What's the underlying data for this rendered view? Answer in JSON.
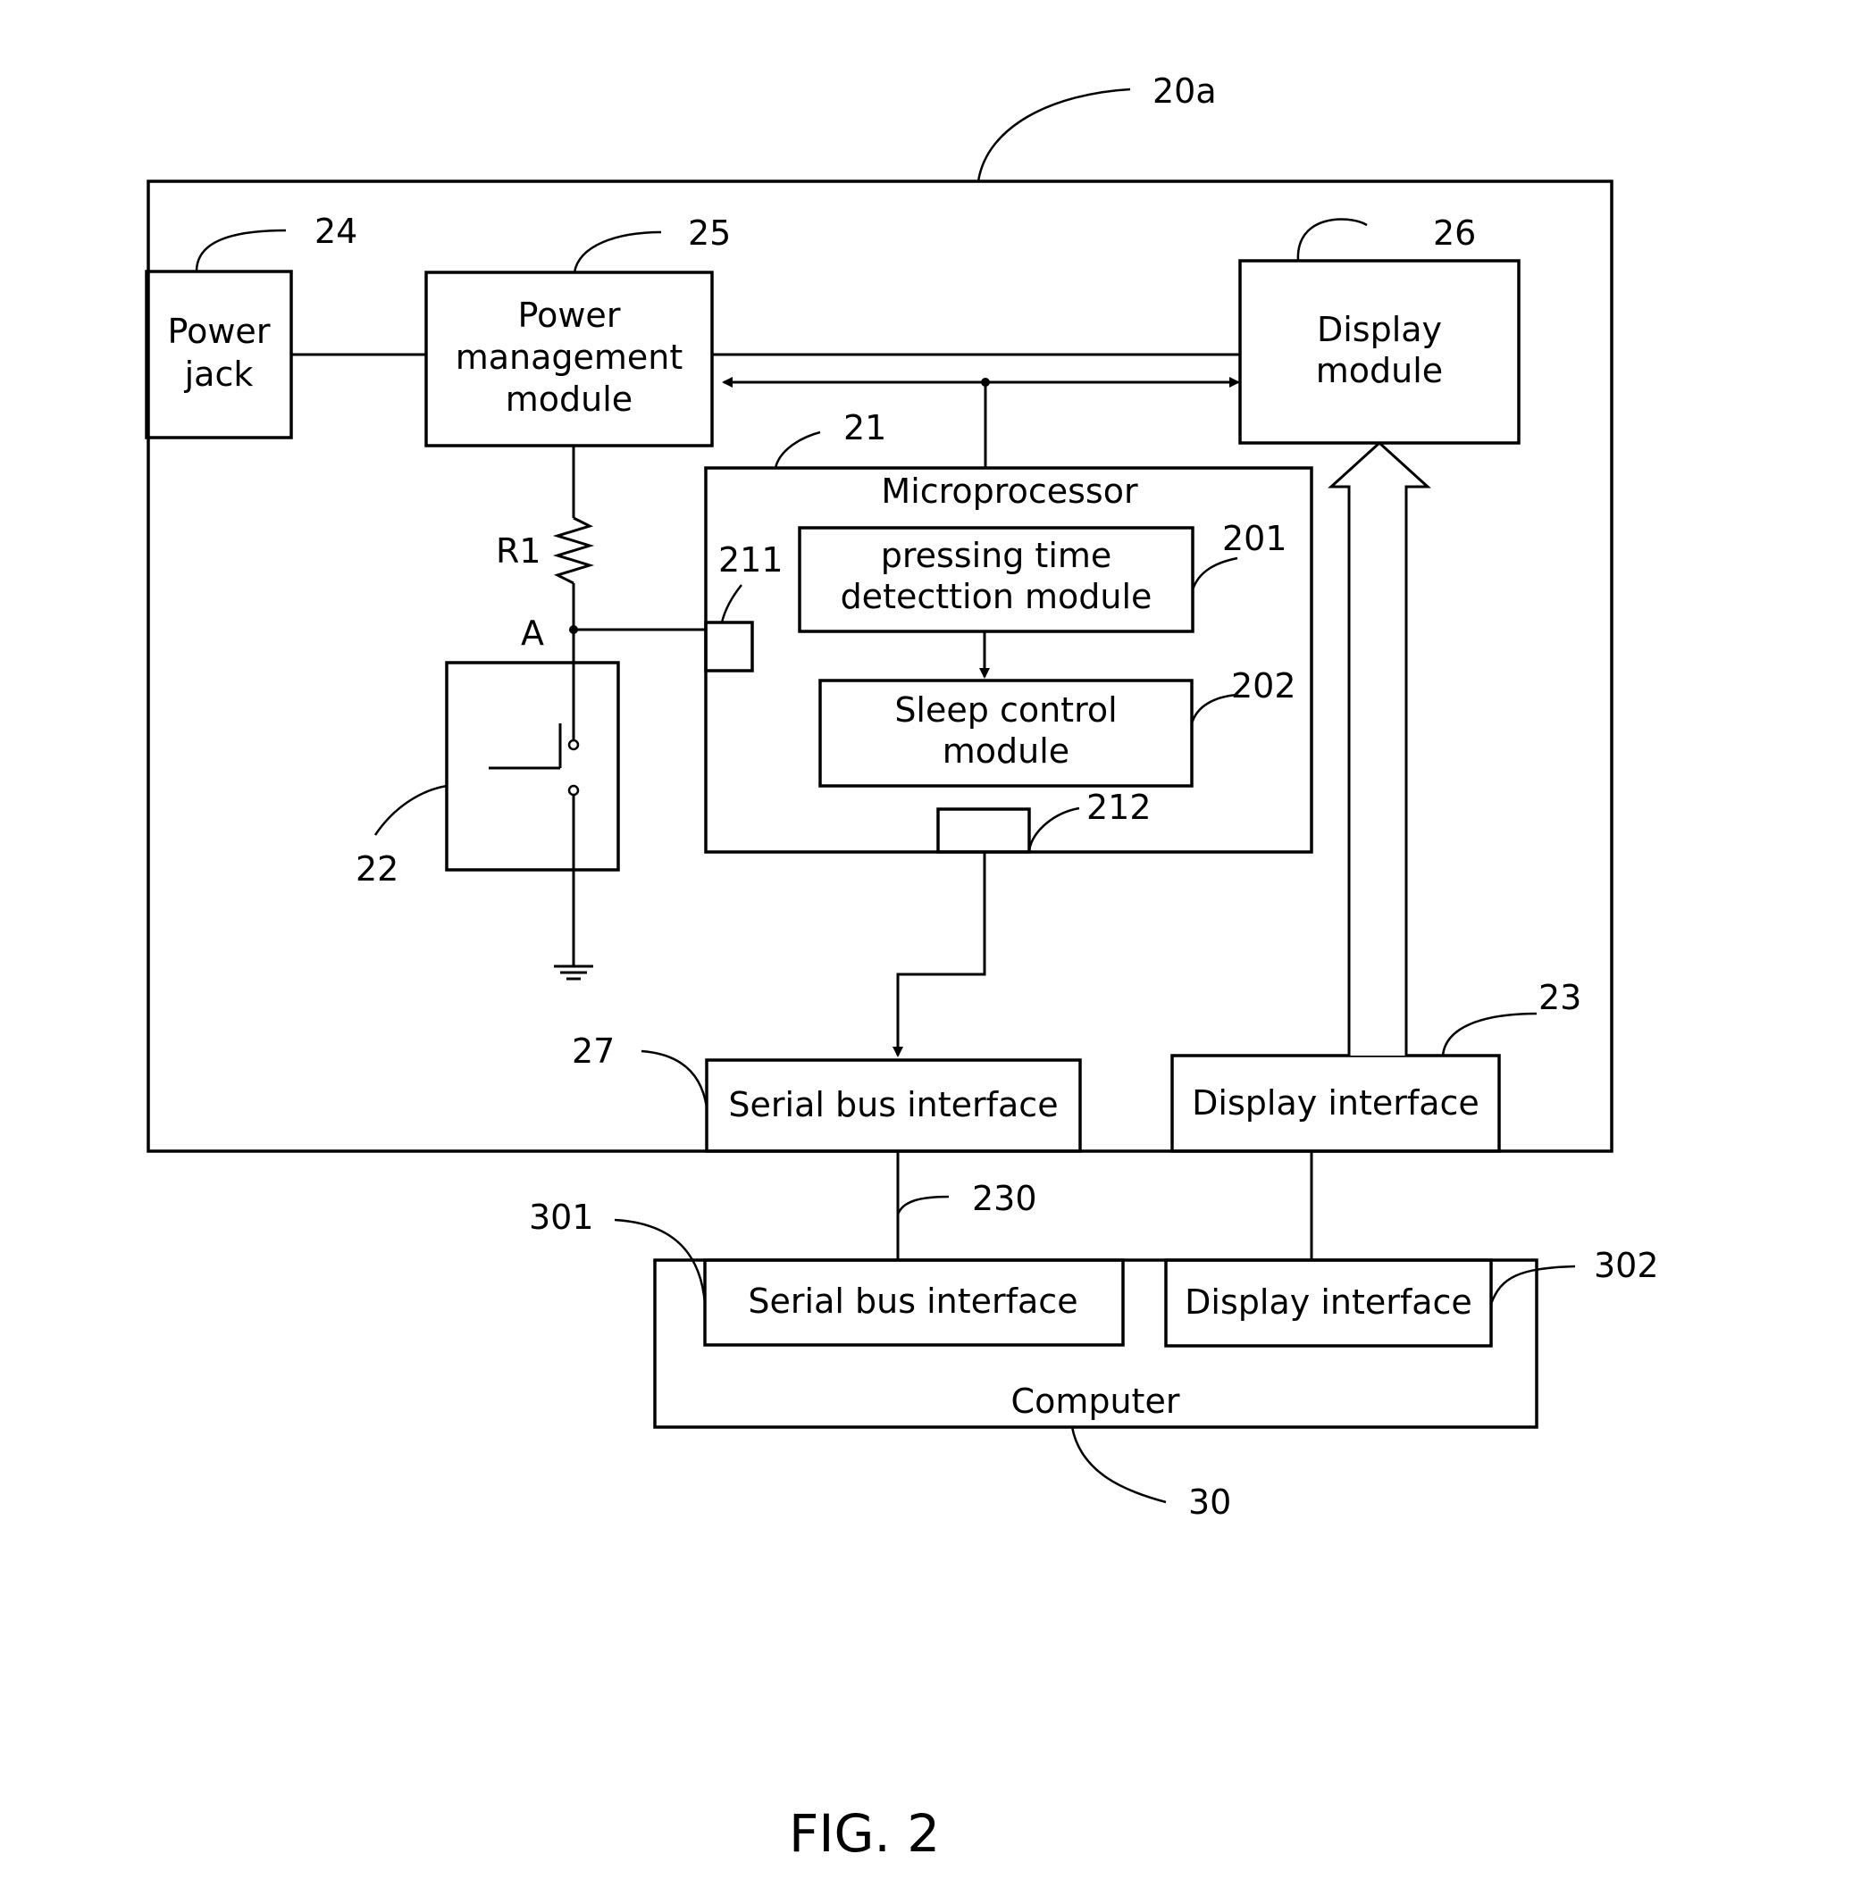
{
  "figure": {
    "caption": "FIG. 2",
    "device_ref": "20a",
    "computer_ref": "30"
  },
  "blocks": {
    "power_jack": {
      "lines": [
        "Power",
        "jack"
      ],
      "ref": "24"
    },
    "power_management": {
      "lines": [
        "Power",
        "management",
        "module"
      ],
      "ref": "25"
    },
    "display_module": {
      "lines": [
        "Display",
        "module"
      ],
      "ref": "26"
    },
    "microprocessor": {
      "label": "Microprocessor",
      "ref": "21"
    },
    "pressing_time_detection": {
      "lines": [
        "pressing time",
        "detecttion module"
      ],
      "ref": "201"
    },
    "sleep_control": {
      "lines": [
        "Sleep control",
        "module"
      ],
      "ref": "202"
    },
    "port_211": {
      "ref": "211"
    },
    "port_212": {
      "ref": "212"
    },
    "switch": {
      "ref": "22"
    },
    "resistor": {
      "label": "R1"
    },
    "node_a": {
      "label": "A"
    },
    "serial_bus_interface_device": {
      "label": "Serial bus interface",
      "ref": "27"
    },
    "display_interface_device": {
      "label": "Display interface",
      "ref": "23"
    },
    "cable": {
      "ref": "230"
    },
    "serial_bus_interface_computer": {
      "label": "Serial bus interface",
      "ref": "301"
    },
    "display_interface_computer": {
      "label": "Display interface",
      "ref": "302"
    },
    "computer": {
      "label": "Computer"
    }
  }
}
